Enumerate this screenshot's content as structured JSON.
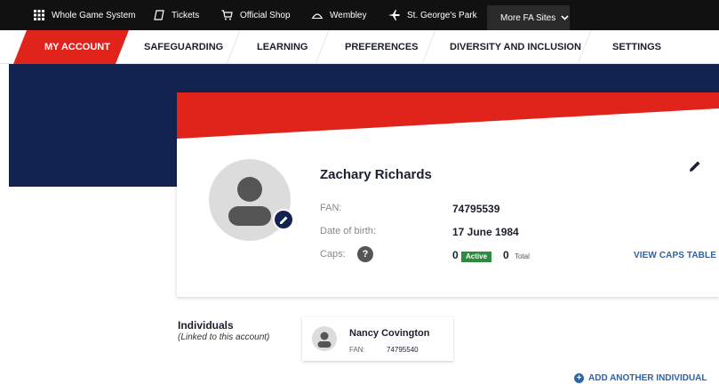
{
  "topbar": {
    "links": [
      {
        "label": "Whole Game System",
        "icon": "grid-icon"
      },
      {
        "label": "Tickets",
        "icon": "ticket-icon"
      },
      {
        "label": "Official Shop",
        "icon": "cart-icon"
      },
      {
        "label": "Wembley",
        "icon": "wembley-arch-icon"
      },
      {
        "label": "St. George's Park",
        "icon": "plane-icon"
      }
    ],
    "more_label": "More FA Sites"
  },
  "nav": {
    "tabs": [
      {
        "label": "MY ACCOUNT",
        "active": true
      },
      {
        "label": "SAFEGUARDING",
        "active": false
      },
      {
        "label": "LEARNING",
        "active": false
      },
      {
        "label": "PREFERENCES",
        "active": false
      },
      {
        "label": "DIVERSITY AND INCLUSION",
        "active": false
      },
      {
        "label": "SETTINGS",
        "active": false
      }
    ]
  },
  "profile": {
    "name": "Zachary Richards",
    "fan_label": "FAN:",
    "fan_value": "74795539",
    "dob_label": "Date of birth:",
    "dob_value": "17 June 1984",
    "caps_label": "Caps:",
    "caps_help": "?",
    "caps_active_value": "0",
    "caps_active_badge": "Active",
    "caps_total_value": "0",
    "caps_total_label": "Total",
    "view_caps_label": "VIEW CAPS TABLE"
  },
  "individuals": {
    "title": "Individuals",
    "subtitle": "(Linked to this account)",
    "items": [
      {
        "name": "Nancy Covington",
        "fan_label": "FAN:",
        "fan_value": "74795540"
      }
    ],
    "add_label": "ADD ANOTHER INDIVIDUAL"
  },
  "colors": {
    "brand_red": "#e0231b",
    "navy": "#12234f",
    "link_blue": "#2d64a8",
    "active_green": "#2e8b3d"
  }
}
